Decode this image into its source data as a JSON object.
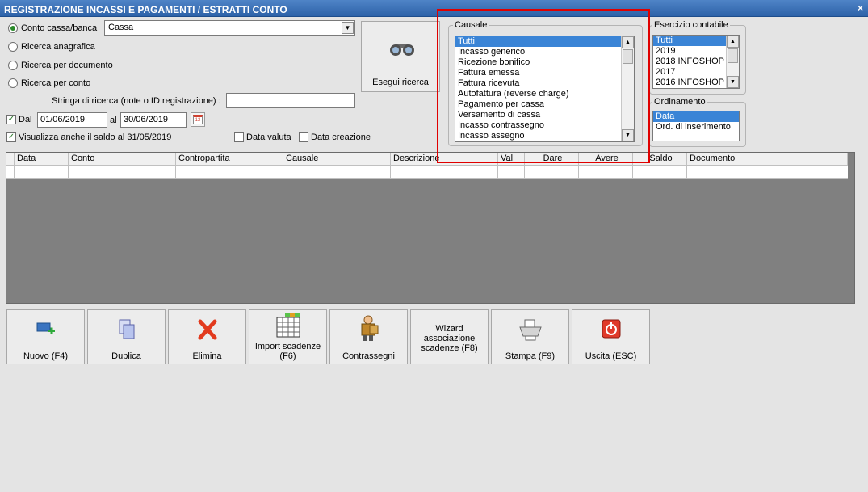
{
  "window": {
    "title": "REGISTRAZIONE INCASSI E PAGAMENTI / ESTRATTI CONTO",
    "close_glyph": "×"
  },
  "search": {
    "options": [
      "Conto cassa/banca",
      "Ricerca anagrafica",
      "Ricerca per documento",
      "Ricerca per conto"
    ],
    "selected_index": 0,
    "conto_value": "Cassa",
    "stringa_label": "Stringa di ricerca (note o ID registrazione) :",
    "stringa_value": "",
    "dal_label": "Dal",
    "dal_value": "01/06/2019",
    "al_label": "al",
    "al_value": "30/06/2019",
    "calendar_icon_text": "12",
    "saldo_label": "Visualizza anche il saldo al 31/05/2019",
    "data_valuta_label": "Data valuta",
    "data_creazione_label": "Data creazione",
    "search_button_label": "Esegui ricerca"
  },
  "causale": {
    "label": "Causale",
    "items": [
      "Tutti",
      "Incasso generico",
      "Ricezione bonifico",
      "Fattura emessa",
      "Fattura ricevuta",
      "Autofattura (reverse charge)",
      "Pagamento per cassa",
      "Versamento di cassa",
      "Incasso contrassegno",
      "Incasso assegno"
    ]
  },
  "esercizio": {
    "label": "Esercizio contabile",
    "items": [
      "Tutti",
      "2019",
      "2018 INFOSHOP",
      "2017",
      "2016 INFOSHOP"
    ]
  },
  "ordinamento": {
    "label": "Ordinamento",
    "items": [
      "Data",
      "Ord. di inserimento"
    ]
  },
  "grid": {
    "columns": [
      "Data",
      "Conto",
      "Contropartita",
      "Causale",
      "Descrizione",
      "Val",
      "Dare",
      "Avere",
      "Saldo",
      "Documento"
    ]
  },
  "toolbar": {
    "buttons": [
      "Nuovo (F4)",
      "Duplica",
      "Elimina",
      "Import scadenze (F6)",
      "Contrassegni",
      "Wizard associazione scadenze (F8)",
      "Stampa (F9)",
      "Uscita (ESC)"
    ],
    "icons": [
      "new-record-icon",
      "duplicate-icon",
      "delete-icon",
      "spreadsheet-icon",
      "courier-icon",
      "wizard-icon",
      "printer-icon",
      "power-icon"
    ]
  },
  "colors": {
    "title_bar": "#3b70b8",
    "selection": "#3a84d6",
    "highlight_border": "#e00000",
    "grid_background": "#808080"
  }
}
